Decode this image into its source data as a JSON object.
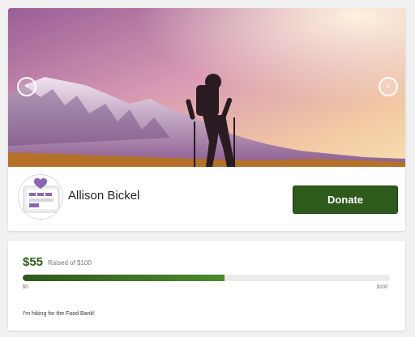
{
  "hero": {
    "prev_icon": "chevron-left-icon",
    "next_icon": "chevron-right-icon",
    "prev_glyph": "‹",
    "next_glyph": "›"
  },
  "fundraiser": {
    "name": "Allison Bickel",
    "donate_label": "Donate"
  },
  "progress": {
    "raised": "$55",
    "raised_of": "Raised of $100",
    "min_label": "$0",
    "max_label": "$100",
    "fraction": 0.55
  },
  "story": "I'm hiking for the Food Bank!",
  "colors": {
    "brand_green": "#2e5a1c",
    "accent_purple": "#8a67b5"
  }
}
